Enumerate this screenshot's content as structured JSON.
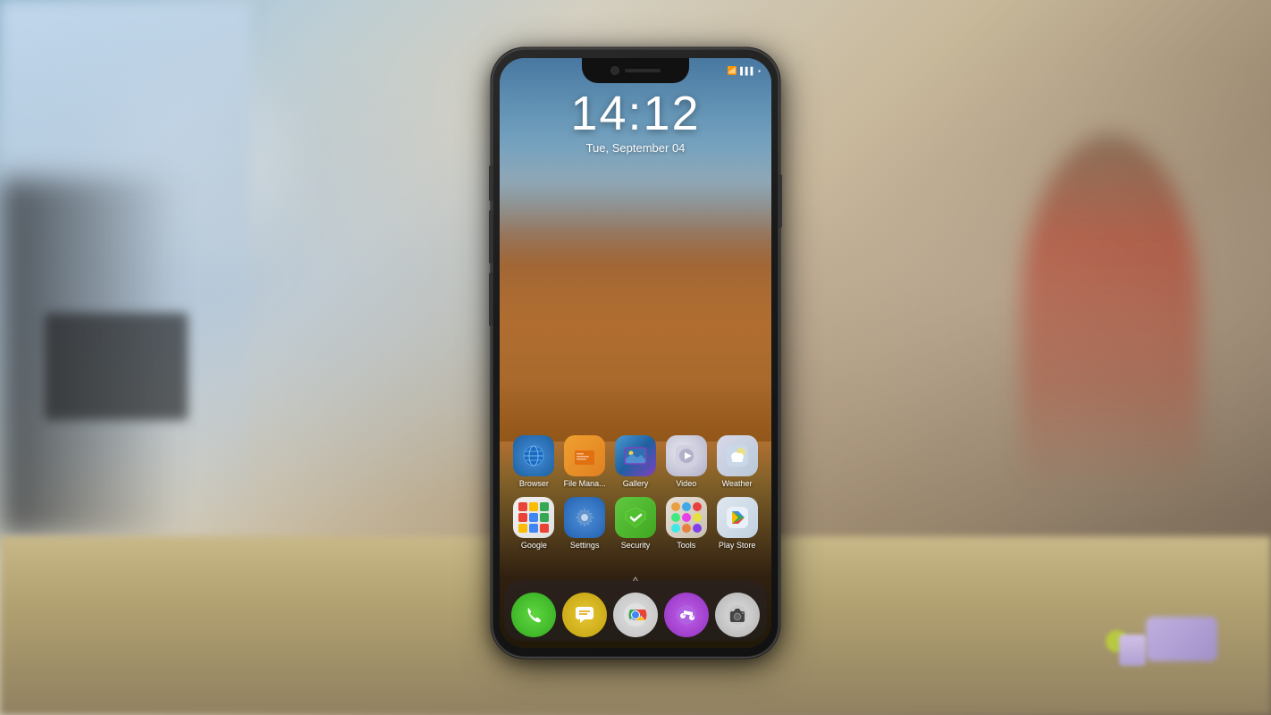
{
  "scene": {
    "title": "Android Phone Home Screen"
  },
  "phone": {
    "screen": {
      "clock": {
        "time": "14:12",
        "date": "Tue, September 04"
      },
      "status_bar": {
        "wifi_icon": "wifi",
        "signal_icon": "signal",
        "battery_icon": "battery"
      },
      "app_rows": [
        {
          "apps": [
            {
              "id": "browser",
              "label": "Browser",
              "icon": "browser"
            },
            {
              "id": "file-manager",
              "label": "File Mana...",
              "icon": "filemanager"
            },
            {
              "id": "gallery",
              "label": "Gallery",
              "icon": "gallery"
            },
            {
              "id": "video",
              "label": "Video",
              "icon": "video"
            },
            {
              "id": "weather",
              "label": "Weather",
              "icon": "weather"
            }
          ]
        },
        {
          "apps": [
            {
              "id": "google",
              "label": "Google",
              "icon": "google"
            },
            {
              "id": "settings",
              "label": "Settings",
              "icon": "settings"
            },
            {
              "id": "security",
              "label": "Security",
              "icon": "security"
            },
            {
              "id": "tools",
              "label": "Tools",
              "icon": "tools"
            },
            {
              "id": "play-store",
              "label": "Play Store",
              "icon": "playstore"
            }
          ]
        }
      ],
      "dock": {
        "apps": [
          {
            "id": "phone",
            "label": "Phone",
            "icon": "phone"
          },
          {
            "id": "messages",
            "label": "Messages",
            "icon": "messages"
          },
          {
            "id": "chrome",
            "label": "Chrome",
            "icon": "chrome"
          },
          {
            "id": "music",
            "label": "Music",
            "icon": "music"
          },
          {
            "id": "camera",
            "label": "Camera",
            "icon": "camera"
          }
        ]
      },
      "swipe_hint": "^"
    }
  }
}
